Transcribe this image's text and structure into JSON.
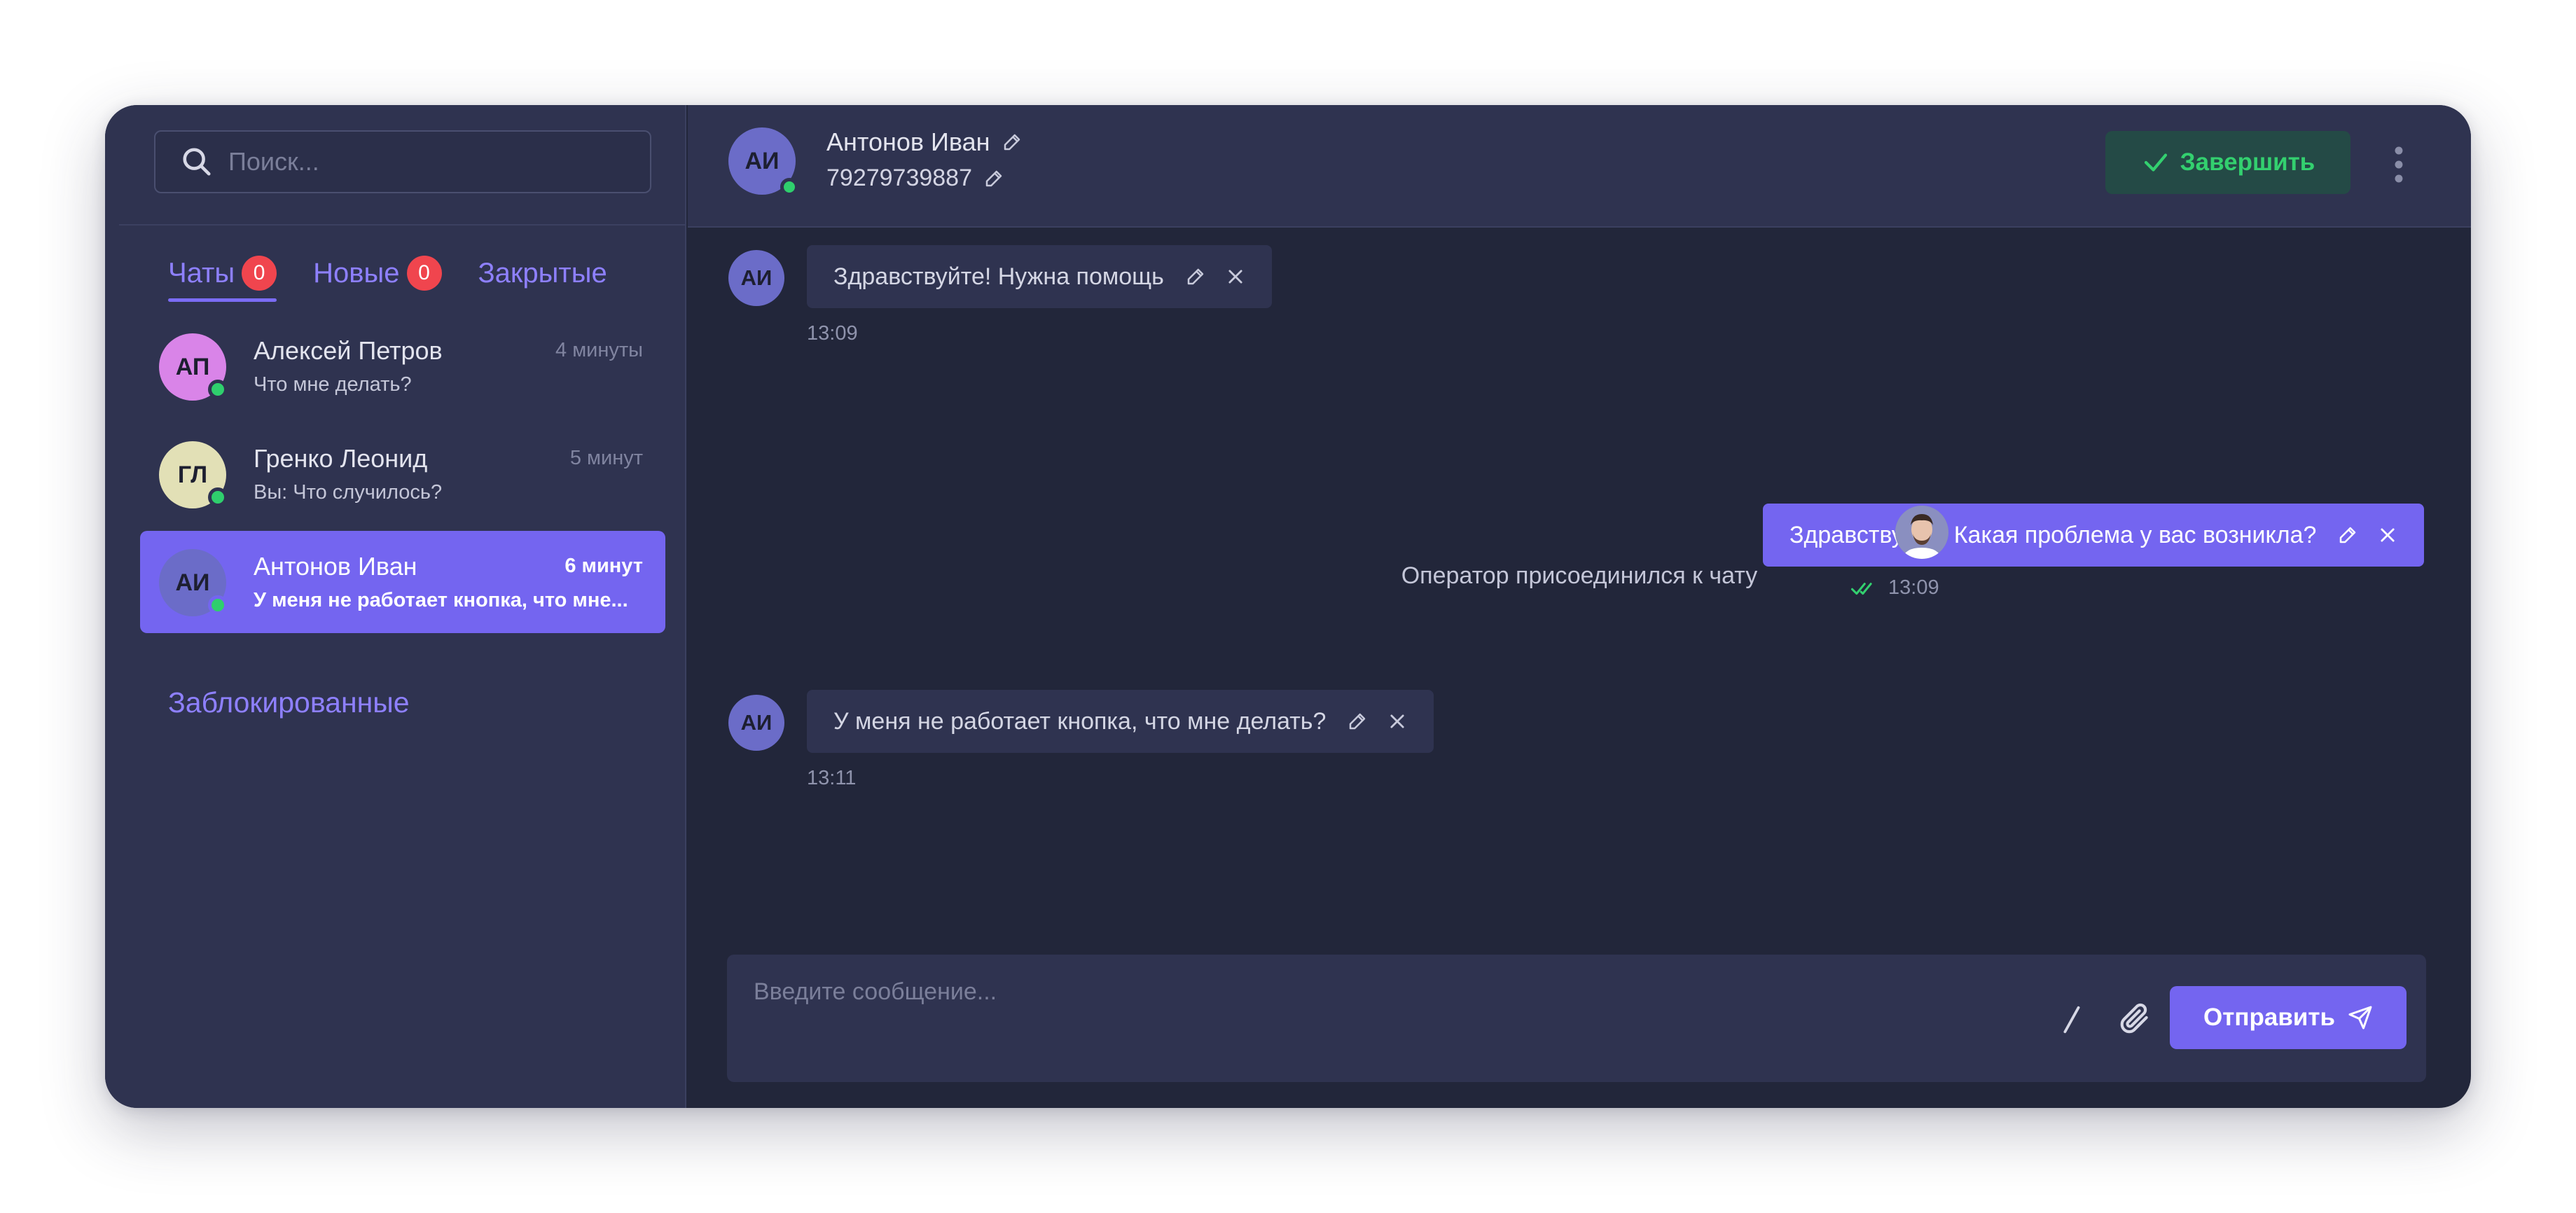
{
  "search": {
    "placeholder": "Поиск..."
  },
  "tabs": [
    {
      "label": "Чаты",
      "badge": "0",
      "active": true
    },
    {
      "label": "Новые",
      "badge": "0",
      "active": false
    },
    {
      "label": "Закрытые",
      "active": false
    }
  ],
  "chats": [
    {
      "initials": "АП",
      "name": "Алексей Петров",
      "preview": "Что мне делать?",
      "time": "4 минуты",
      "avatar_color": "#d984e8",
      "online": true,
      "selected": false
    },
    {
      "initials": "ГЛ",
      "name": "Гренко Леонид",
      "preview": "Вы: Что случилось?",
      "time": "5 минут",
      "avatar_color": "#e2e0b6",
      "online": true,
      "selected": false
    },
    {
      "initials": "АИ",
      "name": "Антонов Иван",
      "preview": "У меня не работает кнопка, что мне...",
      "time": "6 минут",
      "avatar_color": "#6b6cc8",
      "online": true,
      "selected": true
    }
  ],
  "blocked_label": "Заблокированные",
  "header": {
    "initials": "АИ",
    "name": "Антонов Иван",
    "phone": "79279739887",
    "finish_label": "Завершить"
  },
  "messages": [
    {
      "direction": "in",
      "initials": "АИ",
      "text": "Здравствуйте! Нужна помощь",
      "time": "13:09"
    },
    {
      "direction": "system",
      "text": "Оператор присоединился к чату"
    },
    {
      "direction": "out",
      "text": "Здравствуйте! Какая проблема у вас возникла?",
      "time": "13:09",
      "status": "read"
    },
    {
      "direction": "in",
      "initials": "АИ",
      "text": "У меня не работает кнопка, что мне делать?",
      "time": "13:11"
    }
  ],
  "composer": {
    "placeholder": "Введите сообщение...",
    "send_label": "Отправить"
  },
  "colors": {
    "accent": "#7465f0",
    "success": "#33d06f",
    "badge": "#f0454e",
    "background": "#22263a",
    "panel": "#2f3350"
  },
  "icons": [
    "search-icon",
    "pencil-icon",
    "check-icon",
    "more-vertical-icon",
    "close-icon",
    "double-check-icon",
    "slash-icon",
    "paperclip-icon",
    "send-icon"
  ]
}
